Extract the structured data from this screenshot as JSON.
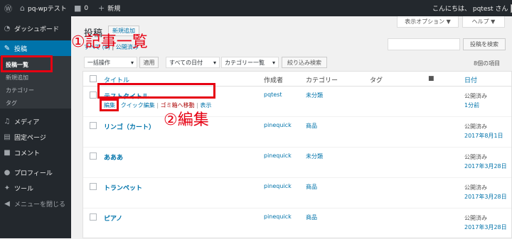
{
  "adminbar": {
    "site_name": "pq-wpテスト",
    "comments_count": "0",
    "new_label": "新規",
    "greeting": "こんにちは、 pqtest さん"
  },
  "sidebar": {
    "items": [
      {
        "label": "ダッシュボード",
        "icon": "dashboard-icon"
      },
      {
        "label": "投稿",
        "icon": "pin-icon"
      },
      {
        "label": "メディア",
        "icon": "media-icon"
      },
      {
        "label": "固定ページ",
        "icon": "page-icon"
      },
      {
        "label": "コメント",
        "icon": "comment-icon"
      },
      {
        "label": "プロフィール",
        "icon": "profile-icon"
      },
      {
        "label": "ツール",
        "icon": "tool-icon"
      },
      {
        "label": "メニューを閉じる",
        "icon": "collapse-icon"
      }
    ],
    "submenu": [
      "投稿一覧",
      "新規追加",
      "カテゴリー",
      "タグ"
    ]
  },
  "screen_options": "表示オプション ▼",
  "help": "ヘルプ ▼",
  "page_title": "投稿",
  "add_new": "新規追加",
  "subsubsub": {
    "all": "すべて (8)",
    "published": "公開済み"
  },
  "search_button": "投稿を検索",
  "filters": {
    "bulk_action": "一括操作",
    "apply": "適用",
    "dates": "すべての日付",
    "categories": "カテゴリー一覧",
    "filter": "絞り込み検索"
  },
  "items_count": "8個の項目",
  "columns": {
    "title": "タイトル",
    "author": "作成者",
    "category": "カテゴリー",
    "tags": "タグ",
    "date": "日付"
  },
  "row_actions": {
    "edit": "編集",
    "quick_edit": "クイック編集",
    "trash": "ゴミ箱へ移動",
    "view": "表示"
  },
  "posts": [
    {
      "title": "テストタイトル",
      "author": "pqtest",
      "category": "未分類",
      "status": "公開済み",
      "date": "1分前"
    },
    {
      "title": "リンゴ（カート）",
      "author": "pinequick",
      "category": "商品",
      "status": "公開済み",
      "date": "2017年8月1日"
    },
    {
      "title": "あああ",
      "author": "pinequick",
      "category": "未分類",
      "status": "公開済み",
      "date": "2017年3月28日"
    },
    {
      "title": "トランペット",
      "author": "pinequick",
      "category": "商品",
      "status": "公開済み",
      "date": "2017年3月28日"
    },
    {
      "title": "ピアノ",
      "author": "pinequick",
      "category": "商品",
      "status": "公開済み",
      "date": "2017年3月28日"
    }
  ],
  "annotations": {
    "step1": "①記事一覧",
    "step2": "②編集"
  },
  "colors": {
    "accent": "#0073aa",
    "highlight": "#e60012",
    "adminbar": "#23282d"
  }
}
